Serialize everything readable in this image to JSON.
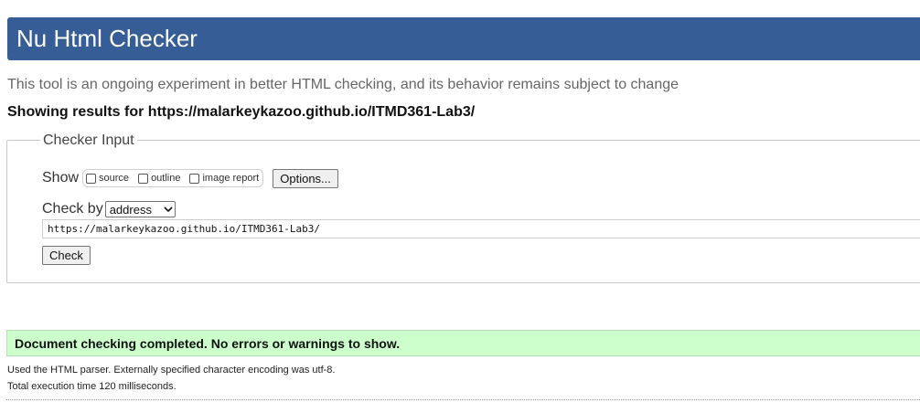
{
  "header": {
    "title": "Nu Html Checker"
  },
  "subtitle": "This tool is an ongoing experiment in better HTML checking, and its behavior remains subject to change",
  "showing_results": "Showing results for https://malarkeykazoo.github.io/ITMD361-Lab3/",
  "checker_input": {
    "legend": "Checker Input",
    "show_label": "Show",
    "show_options": [
      {
        "label": "source",
        "checked": false
      },
      {
        "label": "outline",
        "checked": false
      },
      {
        "label": "image report",
        "checked": false
      }
    ],
    "options_button": "Options...",
    "check_by_label": "Check by",
    "check_by_selected": "address",
    "url_value": "https://malarkeykazoo.github.io/ITMD361-Lab3/",
    "check_button": "Check"
  },
  "result": {
    "message": "Document checking completed. No errors or warnings to show.",
    "parser_info": "Used the HTML parser. Externally specified character encoding was utf-8.",
    "execution_time": "Total execution time 120 milliseconds."
  },
  "colors": {
    "header_bg": "#365d95",
    "success_bg": "#ccffcc"
  }
}
